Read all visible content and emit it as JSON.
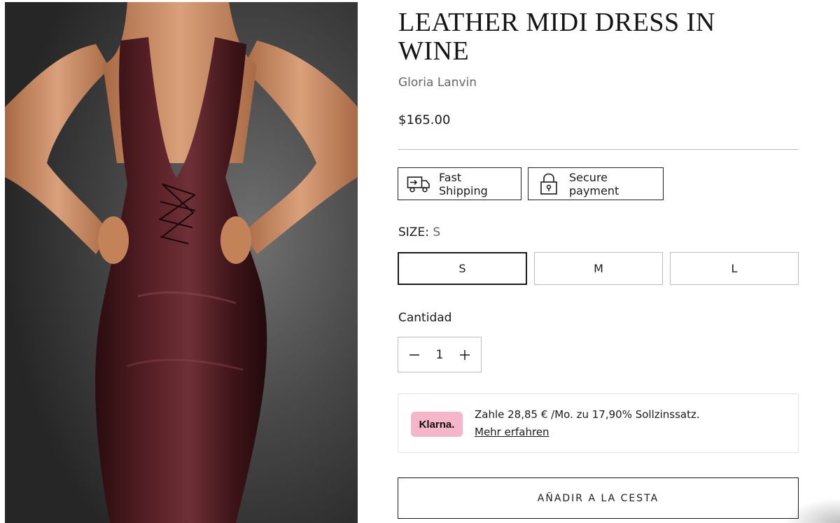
{
  "product": {
    "title": "LEATHER MIDI DRESS IN WINE",
    "vendor": "Gloria Lanvin",
    "price": "$165.00",
    "image_alt": "Model wearing wine leather halter midi dress with lace-up corset"
  },
  "badges": {
    "shipping": {
      "label": "Fast Shipping",
      "icon": "truck-icon"
    },
    "payment": {
      "label": "Secure payment",
      "icon": "lock-icon"
    }
  },
  "size": {
    "label": "SIZE:",
    "selected": "S",
    "options": [
      "S",
      "M",
      "L"
    ]
  },
  "quantity": {
    "label": "Cantidad",
    "value": "1",
    "decrement_symbol": "−",
    "increment_symbol": "+"
  },
  "klarna": {
    "logo_text": "Klarna.",
    "message": "Zahle 28,85 € /Mo. zu 17,90% Sollzinssatz.",
    "link": "Mehr erfahren"
  },
  "cart": {
    "add_label": "AÑADIR A LA CESTA"
  },
  "colors": {
    "dress": "#4a1a1e",
    "skin": "#c98a62",
    "klarna_pink": "#f5b6c9",
    "border": "#bdbdbd"
  }
}
